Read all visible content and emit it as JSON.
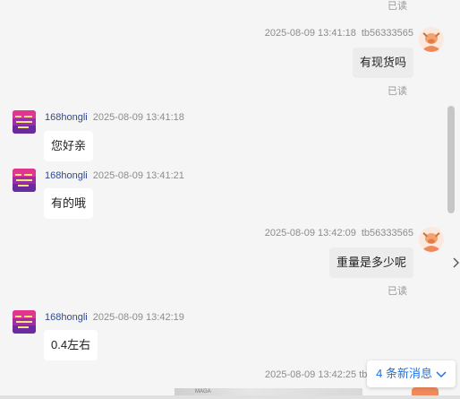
{
  "messages": {
    "top_read_status": "已读",
    "m1": {
      "time": "2025-08-09 13:41:18",
      "sender": "tb56333565",
      "text": "有现货吗",
      "status": "已读"
    },
    "m2": {
      "sender": "168hongli",
      "time": "2025-08-09 13:41:18",
      "text": "您好亲"
    },
    "m3": {
      "sender": "168hongli",
      "time": "2025-08-09 13:41:21",
      "text": "有的哦"
    },
    "m4": {
      "time": "2025-08-09 13:42:09",
      "sender": "tb56333565",
      "text": "重量是多少呢",
      "status": "已读"
    },
    "m5": {
      "sender": "168hongli",
      "time": "2025-08-09 13:42:19",
      "text": "0.4左右"
    },
    "m6": {
      "time": "2025-08-09 13:42:25",
      "sender_partial": "tb"
    }
  },
  "new_messages_label": "4 条新消息",
  "image_caption": "MAGA",
  "colors": {
    "background": "#f5f5f5",
    "my_bubble": "#ececec",
    "their_bubble": "#ffffff",
    "link_blue": "#1a73e8",
    "sender_name": "#2b4a9a"
  },
  "icons": {
    "seller_avatar": "purple-pink-store-logo",
    "buyer_avatar": "orange-cow-avatar",
    "new_messages": "chevron-down-icon",
    "side_chevron": "chevron-right-icon"
  }
}
